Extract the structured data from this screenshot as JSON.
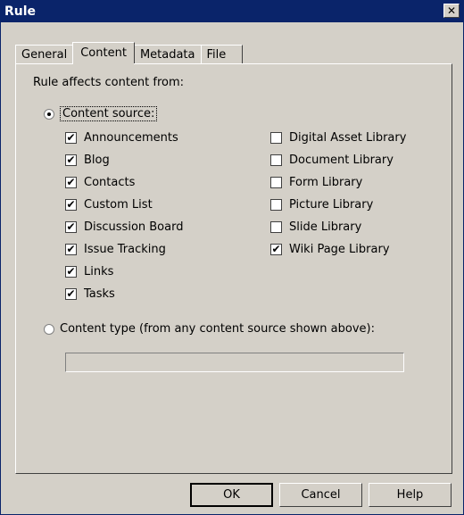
{
  "window": {
    "title": "Rule",
    "close_glyph": "✕"
  },
  "tabs": [
    {
      "label": "General"
    },
    {
      "label": "Content"
    },
    {
      "label": "Metadata"
    },
    {
      "label": "File"
    }
  ],
  "content": {
    "affects_label": "Rule affects content from:",
    "content_source_label": "Content source:",
    "content_source_selected": true,
    "left_sources": [
      {
        "label": "Announcements",
        "checked": true
      },
      {
        "label": "Blog",
        "checked": true
      },
      {
        "label": "Contacts",
        "checked": true
      },
      {
        "label": "Custom List",
        "checked": true
      },
      {
        "label": "Discussion Board",
        "checked": true
      },
      {
        "label": "Issue Tracking",
        "checked": true
      },
      {
        "label": "Links",
        "checked": true
      },
      {
        "label": "Tasks",
        "checked": true
      }
    ],
    "right_sources": [
      {
        "label": "Digital Asset Library",
        "checked": false
      },
      {
        "label": "Document Library",
        "checked": false
      },
      {
        "label": "Form Library",
        "checked": false
      },
      {
        "label": "Picture Library",
        "checked": false
      },
      {
        "label": "Slide Library",
        "checked": false
      },
      {
        "label": "Wiki Page Library",
        "checked": true
      }
    ],
    "content_type_label": "Content type (from any content source shown above):",
    "content_type_selected": false,
    "content_type_value": ""
  },
  "buttons": {
    "ok": "OK",
    "cancel": "Cancel",
    "help": "Help"
  },
  "check_glyph": "✔"
}
